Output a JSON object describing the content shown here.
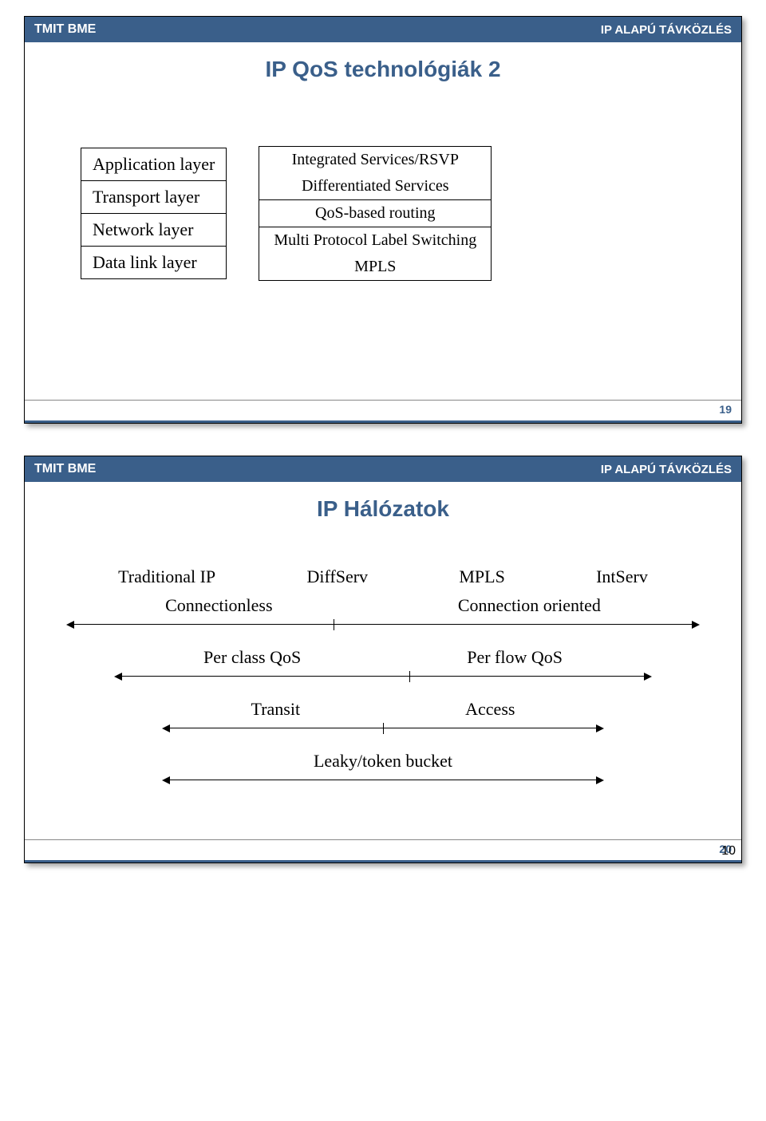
{
  "header_left": "TMIT BME",
  "header_right": "IP ALAPÚ TÁVKÖZLÉS",
  "slide19": {
    "title": "IP QoS technológiák 2",
    "layers": [
      "Application layer",
      "Transport layer",
      "Network layer",
      "Data link layer"
    ],
    "right_rows": [
      "Integrated Services/RSVP",
      "Differentiated Services",
      "QoS-based routing",
      "Multi Protocol Label Switching",
      "MPLS"
    ],
    "number": "19"
  },
  "slide20": {
    "title": "IP Hálózatok",
    "row1": [
      "Traditional IP",
      "DiffServ",
      "MPLS",
      "IntServ"
    ],
    "row2": [
      "Connectionless",
      "Connection oriented"
    ],
    "row3": [
      "Per class QoS",
      "Per flow QoS"
    ],
    "row4": [
      "Transit",
      "Access"
    ],
    "row5": [
      "Leaky/token bucket"
    ],
    "number": "20"
  },
  "page_number": "10"
}
